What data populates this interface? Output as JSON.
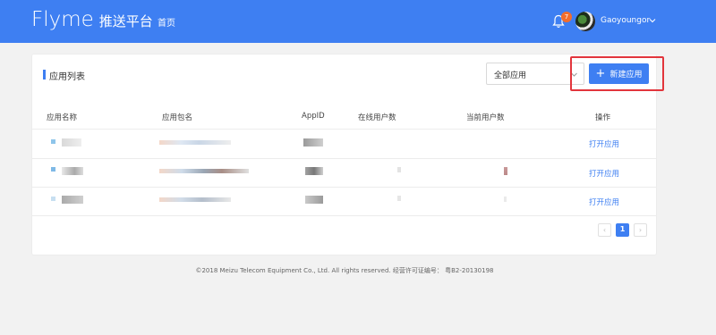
{
  "header": {
    "logo_word": "Flyme",
    "logo_sub": "推送平台",
    "nav_home": "首页",
    "notification_count": "7",
    "username": "Gaoyoungor"
  },
  "card": {
    "title": "应用列表",
    "filter_value": "全部应用",
    "new_button_label": "新建应用"
  },
  "table": {
    "columns": [
      "应用名称",
      "应用包名",
      "AppID",
      "在线用户数",
      "当前用户数",
      "操作"
    ],
    "rows": [
      {
        "action": "打开应用"
      },
      {
        "action": "打开应用"
      },
      {
        "action": "打开应用"
      }
    ]
  },
  "pagination": {
    "current_page": "1",
    "prev": "‹",
    "next": "›"
  },
  "footer": {
    "text": "©2018 Meizu Telecom Equipment Co., Ltd. All rights reserved. 经营许可证编号： 粤B2-20130198"
  },
  "colors": {
    "primary": "#3e7ff2",
    "badge": "#f26d2c",
    "highlight": "#e2353c"
  }
}
